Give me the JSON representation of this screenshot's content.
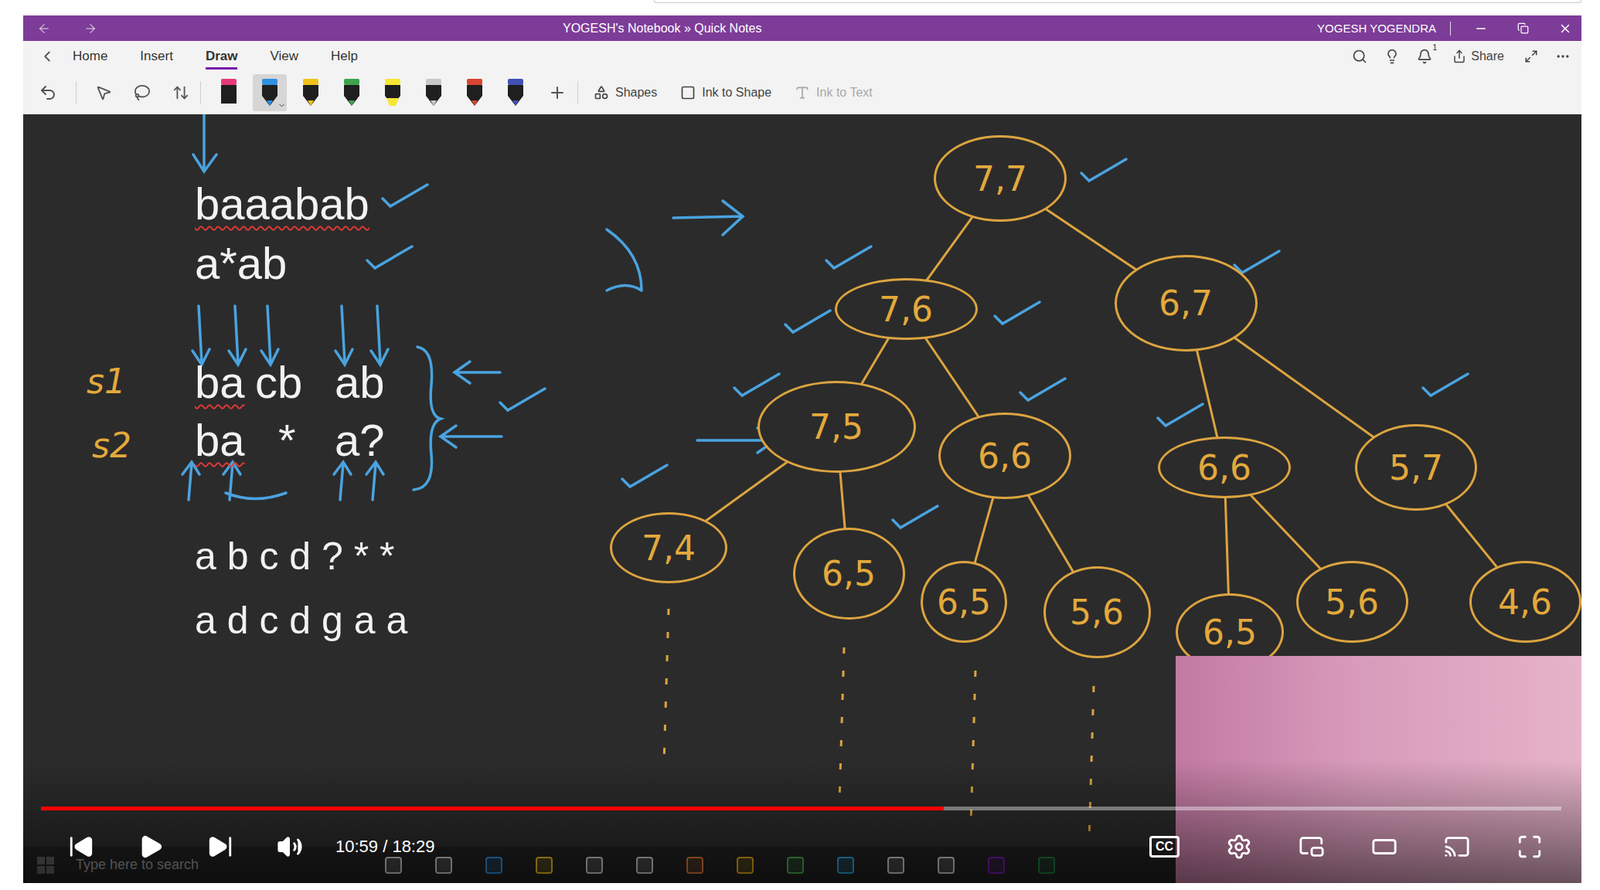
{
  "onenote": {
    "title": "YOGESH's Notebook » Quick Notes",
    "user": "YOGESH YOGENDRA",
    "ribbon_tabs": [
      {
        "label": "Home",
        "selected": false
      },
      {
        "label": "Insert",
        "selected": false
      },
      {
        "label": "Draw",
        "selected": true
      },
      {
        "label": "View",
        "selected": false
      },
      {
        "label": "Help",
        "selected": false
      }
    ],
    "notification_count": "1",
    "share": "Share",
    "pens": [
      {
        "kind": "eraser",
        "color": "#e5397a",
        "selected": false
      },
      {
        "kind": "pen",
        "color": "#2f8fe0",
        "selected": true
      },
      {
        "kind": "pen",
        "color": "#f2c21b",
        "selected": false
      },
      {
        "kind": "pen",
        "color": "#3fa34d",
        "selected": false
      },
      {
        "kind": "highlighter",
        "color": "#f7e733",
        "selected": false
      },
      {
        "kind": "pen",
        "color": "#c8c8c8",
        "selected": false
      },
      {
        "kind": "pen",
        "color": "#d8452f",
        "selected": false
      },
      {
        "kind": "pen",
        "color": "#3f51b5",
        "selected": false
      }
    ],
    "tools": [
      {
        "label": "Shapes",
        "disabled": false
      },
      {
        "label": "Ink to Shape",
        "disabled": false
      },
      {
        "label": "Ink to Text",
        "disabled": true
      }
    ],
    "canvas": {
      "typed_text": [
        {
          "text": "baaabab",
          "misspelled": true
        },
        {
          "text": "a*ab",
          "misspelled": false
        },
        {
          "text": "ba",
          "misspelled": true
        },
        {
          "text": "cb",
          "misspelled": false
        },
        {
          "text": "ab",
          "misspelled": false
        },
        {
          "text": "ba",
          "misspelled": true
        },
        {
          "text": "*",
          "misspelled": false
        },
        {
          "text": "a?",
          "misspelled": false
        },
        {
          "text": "a b c d ? * *",
          "misspelled": false
        },
        {
          "text": "a d c d g a a",
          "misspelled": false
        }
      ],
      "handwritten_labels": [
        "s1",
        "s2"
      ],
      "tree_nodes": [
        {
          "label": "7,7",
          "parent": null
        },
        {
          "label": "7,6",
          "parent": 0
        },
        {
          "label": "6,7",
          "parent": 0
        },
        {
          "label": "7,5",
          "parent": 1
        },
        {
          "label": "6,6",
          "parent": 1
        },
        {
          "label": "6,6",
          "parent": 2
        },
        {
          "label": "5,7",
          "parent": 2
        },
        {
          "label": "7,4",
          "parent": 3
        },
        {
          "label": "6,5",
          "parent": 3
        },
        {
          "label": "6,5",
          "parent": 4
        },
        {
          "label": "5,6",
          "parent": 4
        },
        {
          "label": "6,5",
          "parent": 5
        },
        {
          "label": "5,6",
          "parent": 5
        },
        {
          "label": "4,6",
          "parent": 6
        }
      ]
    }
  },
  "taskbar": {
    "search_placeholder": "Type here to search"
  },
  "player": {
    "time": "10:59 / 18:29",
    "progress": 0.594,
    "captions_label": "CC",
    "playing": false
  }
}
